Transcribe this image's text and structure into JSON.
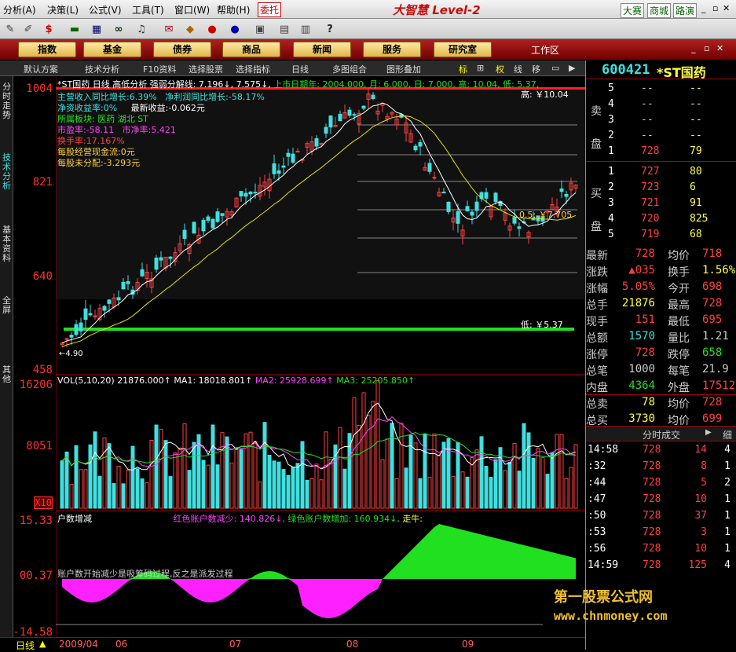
{
  "menubar": {
    "items": [
      "分析(A)",
      "决策(L)",
      "公式(V)",
      "工具(T)",
      "窗口(W)",
      "帮助(H)"
    ],
    "tag": "委托",
    "brand": "大智慧 Level-2",
    "right": [
      "大赛",
      "商城",
      "路演"
    ]
  },
  "sections": [
    "指数",
    "基金",
    "债券",
    "商品",
    "新闻",
    "服务",
    "研究室"
  ],
  "workspace": "工作区",
  "toolrow": [
    "默认方案",
    "技术分析",
    "F10资料",
    "选择股票",
    "选择指标",
    "日线",
    "多图组合",
    "图形叠加",
    "标",
    "权",
    "线",
    "移"
  ],
  "left_tabs": [
    "分时走势",
    "技术分析",
    "基本资料",
    "全屏",
    "其他"
  ],
  "price_axis": [
    "1004",
    "821",
    "640",
    "458"
  ],
  "vol_axis": [
    "16206",
    "8051",
    "X10"
  ],
  "ind_axis": [
    "15.33",
    "00.37",
    "-14.58"
  ],
  "chart_header": {
    "title": "*ST国药",
    "period": "日线",
    "l1a": "高低分析  强弱分解线: 7.196↓, 7.575↓,",
    "l1b": "上市日期年: 2004.000, 月: 6.000, 日: 7.000, 高: 10.04, 低: 5.37,",
    "f1": "主营收入同比增长:6.39%",
    "f1b": "净利润同比增长:-58.17%",
    "f2": "净资收益率:0%",
    "f2b": "最新收益:-0.062元",
    "f3": "所属板块: 医药 湖北 ST",
    "f4": "市盈率:-58.11",
    "f4b": "市净率:5.421",
    "f5": "换手率:17.167%",
    "f6": "每股经营现金流:0元",
    "f7": "每股未分配:-3.293元",
    "high": "高: ￥10.04",
    "low": "低: ￥5.37",
    "low_mark": "←4.90",
    "mid": "0.5: ￥7.705"
  },
  "vol_header": {
    "prefix": "VOL(5,10,20)",
    "v": "21876.000↑",
    "ma1": "MA1: 18018.801↑",
    "ma2": "MA2: 25928.699↑",
    "ma3": "MA3: 25205.850↑"
  },
  "ind_header": {
    "name": "户数增减",
    "red": "红色账户数减少: 140.826↓,",
    "green": "绿色账户数增加: 160.934↓,",
    "flag": "走牛:",
    "note": "账户数开始减少是吸筹码过程,反之是派发过程"
  },
  "timeline": [
    "日线",
    "2009/04",
    "06",
    "07",
    "08",
    "09"
  ],
  "quote": {
    "code": "600421",
    "name": "*ST国药",
    "sell_label": [
      "卖",
      "盘"
    ],
    "buy_label": [
      "买",
      "盘"
    ],
    "sell": [
      {
        "n": "5",
        "p": "--",
        "v": "--"
      },
      {
        "n": "4",
        "p": "--",
        "v": "--"
      },
      {
        "n": "3",
        "p": "--",
        "v": "--"
      },
      {
        "n": "2",
        "p": "--",
        "v": "--"
      },
      {
        "n": "1",
        "p": "728",
        "v": "79"
      }
    ],
    "buy": [
      {
        "n": "1",
        "p": "727",
        "v": "80"
      },
      {
        "n": "2",
        "p": "723",
        "v": "6"
      },
      {
        "n": "3",
        "p": "721",
        "v": "91"
      },
      {
        "n": "4",
        "p": "720",
        "v": "825"
      },
      {
        "n": "5",
        "p": "719",
        "v": "68"
      }
    ],
    "stats": [
      {
        "l": "最新",
        "v": "728",
        "l2": "均价",
        "v2": "718"
      },
      {
        "l": "涨跌",
        "v": "▲035",
        "l2": "换手",
        "v2": "1.56%"
      },
      {
        "l": "涨幅",
        "v": "5.05%",
        "l2": "今开",
        "v2": "698"
      },
      {
        "l": "总手",
        "v": "21876",
        "l2": "最高",
        "v2": "728"
      },
      {
        "l": "现手",
        "v": "151",
        "l2": "最低",
        "v2": "695"
      },
      {
        "l": "总额",
        "v": "1570",
        "l2": "量比",
        "v2": "1.21"
      },
      {
        "l": "涨停",
        "v": "728",
        "l2": "跌停",
        "v2": "658"
      },
      {
        "l": "总笔",
        "v": "1000",
        "l2": "每笔",
        "v2": "21.9"
      },
      {
        "l": "内盘",
        "v": "4364",
        "l2": "外盘",
        "v2": "17512"
      },
      {
        "l": "总卖",
        "v": "78",
        "l2": "均价",
        "v2": "728"
      },
      {
        "l": "总买",
        "v": "3730",
        "l2": "均价",
        "v2": "699"
      }
    ],
    "ticks_title": "分时成交",
    "ticks_tab": "细",
    "ticks": [
      {
        "t": "14:58",
        "p": "728",
        "v": "14",
        "n": "4"
      },
      {
        "t": ":32",
        "p": "728",
        "v": "8",
        "n": "1"
      },
      {
        "t": ":44",
        "p": "728",
        "v": "5",
        "n": "2"
      },
      {
        "t": ":47",
        "p": "728",
        "v": "10",
        "n": "1"
      },
      {
        "t": ":50",
        "p": "728",
        "v": "37",
        "n": "1"
      },
      {
        "t": ":53",
        "p": "728",
        "v": "3",
        "n": "1"
      },
      {
        "t": ":56",
        "p": "728",
        "v": "10",
        "n": "1"
      },
      {
        "t": "14:59",
        "p": "728",
        "v": "125",
        "n": "4"
      }
    ]
  },
  "watermark": [
    "第一股票公式网",
    "www.chnmoney.com"
  ],
  "colors": {
    "up": "#ff4040",
    "down": "#40e0e0",
    "ma5": "#ffffff",
    "ma10": "#e8e000",
    "green": "#20e020",
    "magenta": "#ff20ff"
  }
}
